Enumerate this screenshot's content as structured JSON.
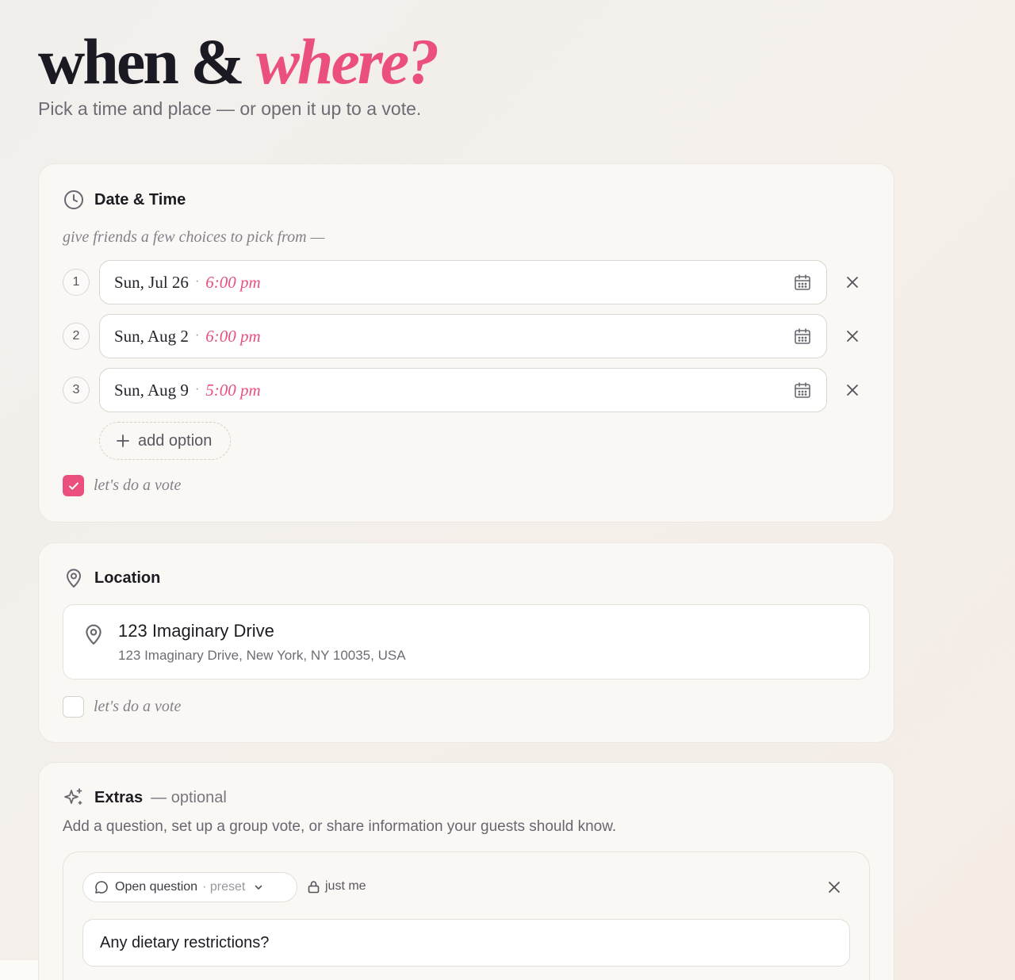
{
  "hero": {
    "title_plain": "when &",
    "title_accent": "where?",
    "subtitle": "Pick a time and place — or open it up to a vote."
  },
  "date_time": {
    "title": "Date & Time",
    "icon": "clock-icon",
    "hint": "give friends a few choices to pick from —",
    "options": [
      {
        "num": "1",
        "date": "Sun, Jul 26",
        "sep": "·",
        "time": "6:00 pm"
      },
      {
        "num": "2",
        "date": "Sun, Aug 2",
        "sep": "·",
        "time": "6:00 pm"
      },
      {
        "num": "3",
        "date": "Sun, Aug 9",
        "sep": "·",
        "time": "5:00 pm"
      }
    ],
    "add_label": "add option",
    "vote_label": "let's do a vote",
    "vote_checked": true
  },
  "location": {
    "title": "Location",
    "icon": "map-pin-icon",
    "name": "123 Imaginary Drive",
    "address": "123 Imaginary Drive, New York, NY 10035, USA",
    "vote_label": "let's do a vote",
    "vote_checked": false
  },
  "extras": {
    "title": "Extras",
    "optional": "— optional",
    "icon": "sparkles-icon",
    "description": "Add a question, set up a group vote, or share information your guests should know.",
    "question": {
      "type_label": "Open question",
      "preset_label": "· preset",
      "visibility_label": "just me",
      "value": "Any dietary restrictions?"
    }
  },
  "colors": {
    "accent": "#ea4f7d",
    "card_bg": "#f9f8f5",
    "text": "#1d1b22",
    "muted": "#6f6b74"
  }
}
